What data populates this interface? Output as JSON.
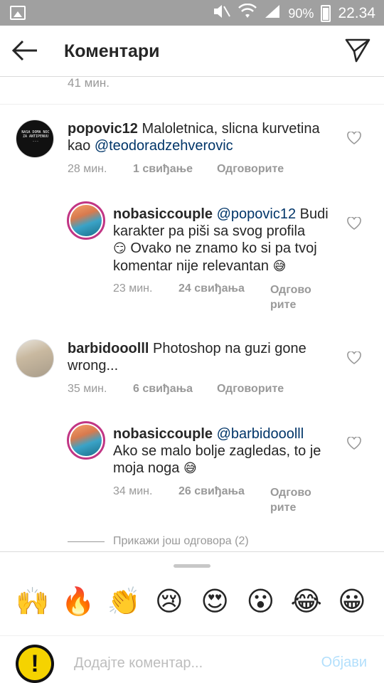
{
  "status_bar": {
    "battery": "90%",
    "time": "22.34",
    "icons": [
      "gallery-icon",
      "mute-icon",
      "wifi-icon",
      "signal-icon",
      "battery-icon"
    ]
  },
  "header": {
    "title": "Коментари",
    "back_icon": "arrow-left-icon",
    "send_icon": "paper-plane-icon"
  },
  "previous_time": "41 мин.",
  "comments": [
    {
      "username": "popovic12",
      "text": "Maloletnica, slicna kurvetina kao",
      "mention": "@teodoradzehverovic",
      "avatar_text": "NASA DOMA NOC ZA ANTIPENUU ...",
      "time": "28 мин.",
      "likes": "1 свиђање",
      "reply": "Одговорите"
    },
    {
      "username": "nobasiccouple",
      "mention": "@popovic12",
      "text_a": "Budi",
      "text_b": "karakter pa piši sa svog profila",
      "emoji1": "😏",
      "text_c": "Ovako ne znamo ko si pa tvoj",
      "text_d": "komentar nije relevantan",
      "emoji2": "😅",
      "time": "23 мин.",
      "likes": "24 свиђања",
      "reply_line1": "Одгово",
      "reply_line2": "рите"
    },
    {
      "username": "barbidooolll",
      "text_a": "Photoshop na guzi gone",
      "text_b": "wrong...",
      "time": "35 мин.",
      "likes": "6 свиђања",
      "reply": "Одговорите"
    },
    {
      "username": "nobasiccouple",
      "mention": "@barbidooolll",
      "text_a": "Ako se malo bolje zagledas, to je",
      "text_b": "moja noga",
      "emoji": "😅",
      "time": "34 мин.",
      "likes": "26 свиђања",
      "reply_line1": "Одгово",
      "reply_line2": "рите"
    }
  ],
  "view_replies": "Прикажи још одговора (2)",
  "emoji_bar": [
    "🙌",
    "🔥",
    "👏",
    "😢",
    "😍",
    "😮",
    "😂",
    "😀"
  ],
  "composer": {
    "placeholder": "Додајте коментар...",
    "post_label": "Објави",
    "avatar_glyph": "!"
  },
  "colors": {
    "mention": "#003569",
    "muted": "#999999",
    "post_disabled": "#b2dffc",
    "status_bar": "#a0a0a0"
  }
}
